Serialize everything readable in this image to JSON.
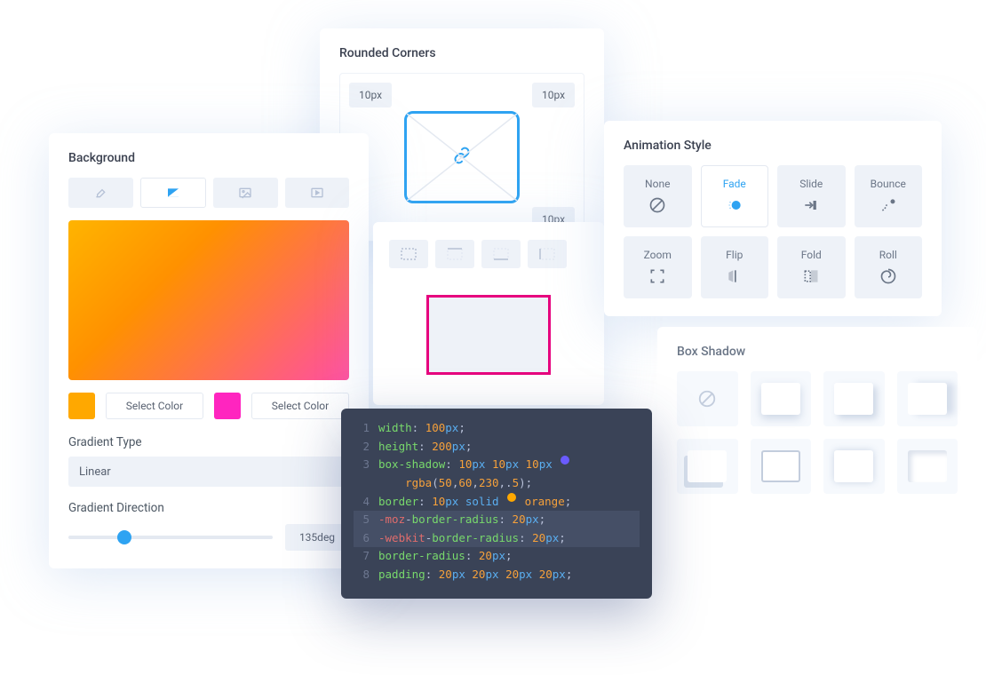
{
  "rounded_corners": {
    "title": "Rounded Corners",
    "tl": "10px",
    "tr": "10px",
    "br": "10px"
  },
  "background": {
    "title": "Background",
    "select_color1": "Select Color",
    "select_color2": "Select Color",
    "swatch1": "#ffa800",
    "swatch2": "#ff25bf",
    "gradient_type_label": "Gradient Type",
    "gradient_type_value": "Linear",
    "gradient_direction_label": "Gradient Direction",
    "gradient_direction_value": "135deg",
    "slider_percent": 24
  },
  "animation": {
    "title": "Animation Style",
    "items": [
      "None",
      "Fade",
      "Slide",
      "Bounce",
      "Zoom",
      "Flip",
      "Fold",
      "Roll"
    ],
    "active_index": 1
  },
  "box_shadow": {
    "title": "Box Shadow"
  },
  "code": {
    "lines": [
      {
        "n": "1",
        "prop": "width",
        "rest": ": 100px;"
      },
      {
        "n": "2",
        "prop": "height",
        "rest": ": 200px;"
      },
      {
        "n": "3",
        "prop": "box-shadow",
        "rest": ": 10px 10px 10px ",
        "swatch": "#6a5bff"
      },
      {
        "n": "",
        "prop": "",
        "rest": "    rgba(50,60,230,.5);"
      },
      {
        "n": "4",
        "prop": "border",
        "rest": ": 10px solid ",
        "swatch": "#ffa800",
        "tail": " orange;"
      },
      {
        "n": "5",
        "prop": "-moz-border-radius",
        "rest": ": 20px;",
        "hl": true
      },
      {
        "n": "6",
        "prop": "-webkit-border-radius",
        "rest": ": 20px;",
        "hl": true
      },
      {
        "n": "7",
        "prop": "border-radius",
        "rest": ": 20px;"
      },
      {
        "n": "8",
        "prop": "padding",
        "rest": ": 20px 20px 20px 20px;"
      }
    ]
  }
}
